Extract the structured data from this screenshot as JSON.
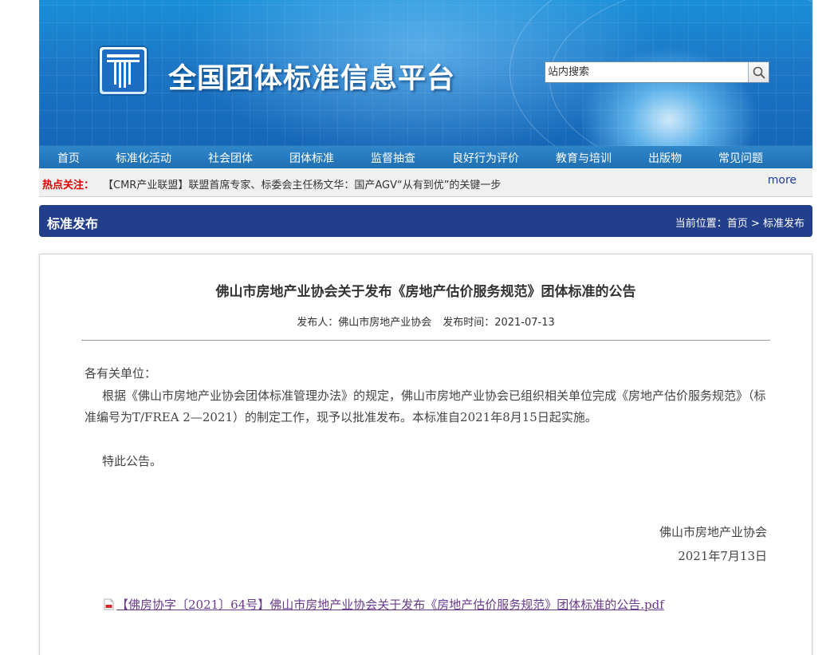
{
  "header": {
    "site_title": "全国团体标准信息平台",
    "search_placeholder": "站内搜索",
    "search_icon": "search-icon",
    "logo_icon": "platform-logo"
  },
  "nav": {
    "items": [
      {
        "label": "首页"
      },
      {
        "label": "标准化活动"
      },
      {
        "label": "社会团体"
      },
      {
        "label": "团体标准"
      },
      {
        "label": "监督抽查"
      },
      {
        "label": "良好行为评价"
      },
      {
        "label": "教育与培训"
      },
      {
        "label": "出版物"
      },
      {
        "label": "常见问题"
      }
    ]
  },
  "hotbar": {
    "label": "热点关注：",
    "item": "【CMR产业联盟】联盟首席专家、标委会主任杨文华：国产AGV“从有到优”的关键一步",
    "more": "more"
  },
  "section": {
    "title": "标准发布",
    "breadcrumb_prefix": "当前位置：",
    "breadcrumb_home": "首页",
    "breadcrumb_sep": ">",
    "breadcrumb_current": "标准发布"
  },
  "article": {
    "title": "佛山市房地产业协会关于发布《房地产估价服务规范》团体标准的公告",
    "publisher_label": "发布人：",
    "publisher": "佛山市房地产业协会",
    "date_label": "发布时间：",
    "date": "2021-07-13",
    "greeting": "各有关单位：",
    "paragraph": "根据《佛山市房地产业协会团体标准管理办法》的规定，佛山市房地产业协会已组织相关单位完成《房地产估价服务规范》（标准编号为T/FREA 2—2021）的制定工作，现予以批准发布。本标准自2021年8月15日起实施。",
    "closing": "特此公告。",
    "signature_org": "佛山市房地产业协会",
    "signature_date": "2021年7月13日",
    "attachment": "【佛房协字〔2021〕64号】佛山市房地产业协会关于发布《房地产估价服务规范》团体标准的公告.pdf",
    "attachment_icon": "pdf-icon"
  },
  "colors": {
    "nav_bg": "#1f6fb3",
    "section_bg": "#233e8b",
    "hot_label": "#e00000",
    "link_purple": "#6a3a8c"
  }
}
